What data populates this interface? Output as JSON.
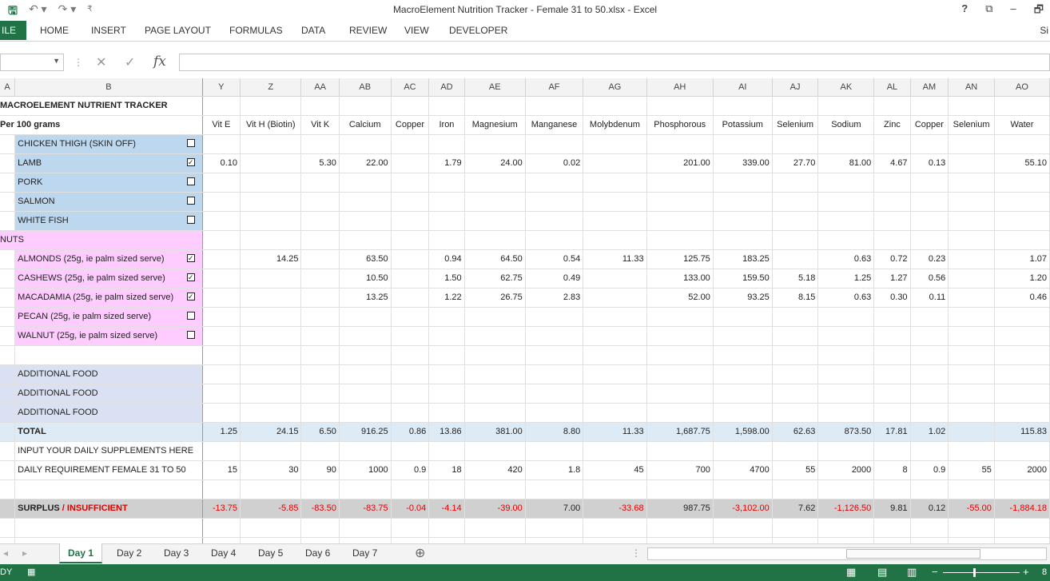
{
  "window": {
    "title": "MacroElement Nutrition Tracker - Female 31 to 50.xlsx - Excel",
    "help": "?",
    "restore_label": "⧉",
    "minimize_label": "–",
    "maximize_label": "🗗"
  },
  "qat": {
    "save": "🖫",
    "undo": "↶ ▾",
    "redo": "↷ ▾",
    "customize": "₹"
  },
  "ribbon": {
    "file": "ILE",
    "tabs": [
      "HOME",
      "INSERT",
      "PAGE LAYOUT",
      "FORMULAS",
      "DATA",
      "REVIEW",
      "VIEW",
      "DEVELOPER"
    ],
    "signin": "Si"
  },
  "formula_bar": {
    "name_box": "",
    "cancel": "✕",
    "enter": "✓",
    "fx": "fx",
    "value": ""
  },
  "columns": [
    "A",
    "B",
    "Y",
    "Z",
    "AA",
    "AB",
    "AC",
    "AD",
    "AE",
    "AF",
    "AG",
    "AH",
    "AI",
    "AJ",
    "AK",
    "AL",
    "AM",
    "AN",
    "AO"
  ],
  "sheet": {
    "title": "MACROELEMENT NUTRIENT TRACKER",
    "per_label": "Per 100 grams",
    "nutrients": [
      "Vit E",
      "Vit H (Biotin)",
      "Vit K",
      "Calcium",
      "Copper",
      "Iron",
      "Magnesium",
      "Manganese",
      "Molybdenum",
      "Phosphorous",
      "Potassium",
      "Selenium",
      "Sodium",
      "Zinc",
      "Copper",
      "Selenium",
      "Water"
    ],
    "meat_rows": [
      {
        "name": "CHICKEN THIGH (SKIN OFF)",
        "check": "",
        "values": [
          "",
          "",
          "",
          "",
          "",
          "",
          "",
          "",
          "",
          "",
          "",
          "",
          "",
          "",
          "",
          "",
          ""
        ]
      },
      {
        "name": "LAMB",
        "check": "✓",
        "values": [
          "0.10",
          "",
          "5.30",
          "22.00",
          "",
          "1.79",
          "24.00",
          "0.02",
          "",
          "201.00",
          "339.00",
          "27.70",
          "81.00",
          "4.67",
          "0.13",
          "",
          "55.10"
        ]
      },
      {
        "name": "PORK",
        "check": "",
        "values": [
          "",
          "",
          "",
          "",
          "",
          "",
          "",
          "",
          "",
          "",
          "",
          "",
          "",
          "",
          "",
          "",
          ""
        ]
      },
      {
        "name": "SALMON",
        "check": "",
        "values": [
          "",
          "",
          "",
          "",
          "",
          "",
          "",
          "",
          "",
          "",
          "",
          "",
          "",
          "",
          "",
          "",
          ""
        ]
      },
      {
        "name": "WHITE FISH",
        "check": "",
        "values": [
          "",
          "",
          "",
          "",
          "",
          "",
          "",
          "",
          "",
          "",
          "",
          "",
          "",
          "",
          "",
          "",
          ""
        ]
      }
    ],
    "nuts_label": "NUTS",
    "nut_rows": [
      {
        "name": "ALMONDS (25g, ie palm sized serve)",
        "check": "✓",
        "values": [
          "",
          "14.25",
          "",
          "63.50",
          "",
          "0.94",
          "64.50",
          "0.54",
          "11.33",
          "125.75",
          "183.25",
          "",
          "0.63",
          "0.72",
          "0.23",
          "",
          "1.07"
        ]
      },
      {
        "name": "CASHEWS (25g, ie palm sized serve)",
        "check": "✓",
        "values": [
          "",
          "",
          "",
          "10.50",
          "",
          "1.50",
          "62.75",
          "0.49",
          "",
          "133.00",
          "159.50",
          "5.18",
          "1.25",
          "1.27",
          "0.56",
          "",
          "1.20"
        ]
      },
      {
        "name": "MACADAMIA (25g, ie palm sized serve)",
        "check": "✓",
        "values": [
          "",
          "",
          "",
          "13.25",
          "",
          "1.22",
          "26.75",
          "2.83",
          "",
          "52.00",
          "93.25",
          "8.15",
          "0.63",
          "0.30",
          "0.11",
          "",
          "0.46"
        ]
      },
      {
        "name": "PECAN (25g, ie palm sized serve)",
        "check": "",
        "values": [
          "",
          "",
          "",
          "",
          "",
          "",
          "",
          "",
          "",
          "",
          "",
          "",
          "",
          "",
          "",
          "",
          ""
        ]
      },
      {
        "name": "WALNUT (25g, ie palm sized serve)",
        "check": "",
        "values": [
          "",
          "",
          "",
          "",
          "",
          "",
          "",
          "",
          "",
          "",
          "",
          "",
          "",
          "",
          "",
          "",
          ""
        ]
      }
    ],
    "additional": [
      "ADDITIONAL FOOD",
      "ADDITIONAL FOOD",
      "ADDITIONAL FOOD"
    ],
    "total_label": "TOTAL",
    "total_values": [
      "1.25",
      "24.15",
      "6.50",
      "916.25",
      "0.86",
      "13.86",
      "381.00",
      "8.80",
      "11.33",
      "1,687.75",
      "1,598.00",
      "62.63",
      "873.50",
      "17.81",
      "1.02",
      "",
      "115.83"
    ],
    "supplements_label": "INPUT YOUR DAILY SUPPLEMENTS HERE",
    "requirement_label": "DAILY REQUIREMENT FEMALE 31 TO 50",
    "requirement_values": [
      "15",
      "30",
      "90",
      "1000",
      "0.9",
      "18",
      "420",
      "1.8",
      "45",
      "700",
      "4700",
      "55",
      "2000",
      "8",
      "0.9",
      "55",
      "2000"
    ],
    "surplus_label": "SURPLUS",
    "insufficient_label": "INSUFFICIENT",
    "surplus_values": [
      "-13.75",
      "-5.85",
      "-83.50",
      "-83.75",
      "-0.04",
      "-4.14",
      "-39.00",
      "7.00",
      "-33.68",
      "987.75",
      "-3,102.00",
      "7.62",
      "-1,126.50",
      "9.81",
      "0.12",
      "-55.00",
      "-1,884.18"
    ]
  },
  "sheet_tabs": [
    "Day 1",
    "Day 2",
    "Day 3",
    "Day 4",
    "Day 5",
    "Day 6",
    "Day 7"
  ],
  "status": {
    "ready": "DY",
    "zoom": "8"
  },
  "colors": {
    "excel_green": "#217346",
    "meat_blue": "#bdd7ee",
    "nuts_pink": "#ffccff",
    "additional_lavender": "#d9e1f2",
    "negative_red": "#e00000"
  }
}
